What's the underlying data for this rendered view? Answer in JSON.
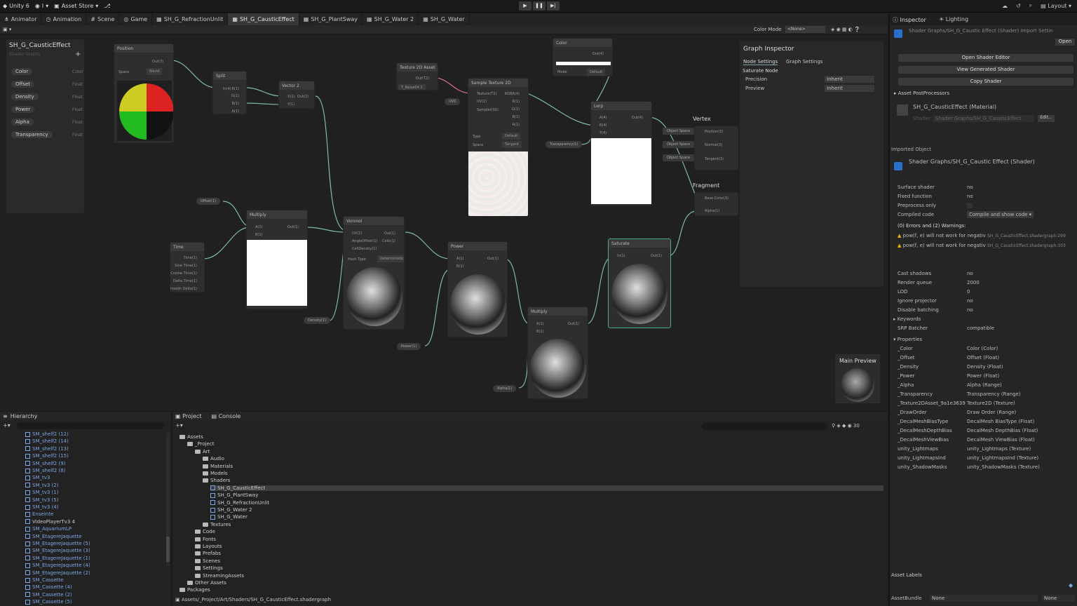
{
  "topbar": {
    "unity": "Unity 6",
    "account": "I",
    "asset_store": "Asset Store",
    "layout": "Layout"
  },
  "tabs": [
    "Animator",
    "Animation",
    "Scene",
    "Game",
    "SH_G_RefractionUnlit",
    "SH_G_CausticEffect",
    "SH_G_PlantSway",
    "SH_G_Water 2",
    "SH_G_Water"
  ],
  "graph_toolbar": {
    "color_mode_label": "Color Mode",
    "color_mode_value": "<None>"
  },
  "blackboard": {
    "title": "SH_G_CausticEffect",
    "subtitle": "Shader Graphs",
    "items": [
      {
        "label": "Color",
        "type": "Color"
      },
      {
        "label": "Offset",
        "type": "Float"
      },
      {
        "label": "Density",
        "type": "Float"
      },
      {
        "label": "Power",
        "type": "Float"
      },
      {
        "label": "Alpha",
        "type": "Float"
      },
      {
        "label": "Transparency",
        "type": "Float"
      }
    ]
  },
  "nodes": {
    "position": {
      "title": "Position",
      "out": "Out(3)",
      "space_label": "Space",
      "space_value": "World"
    },
    "split": {
      "title": "Split",
      "ports": [
        "In(4)",
        "R(1)",
        "G(1)",
        "B(1)",
        "A(1)"
      ]
    },
    "vector2": {
      "title": "Vector 2",
      "ports": [
        "X(1)",
        "Y(1)",
        "Out(2)"
      ]
    },
    "tex2d_asset": {
      "title": "Texture 2D Asset",
      "out": "Out(T2)",
      "asset": "T_Noise04 1"
    },
    "sample_tex": {
      "title": "Sample Texture 2D",
      "ports": [
        "Texture(T2)",
        "UV(2)",
        "Sampler(SS)",
        "RGBA(4)",
        "R(1)",
        "G(1)",
        "B(1)",
        "A(1)"
      ],
      "type_label": "Type",
      "type_value": "Default",
      "space_label": "Space",
      "space_value": "Tangent",
      "uv": "UV0"
    },
    "color": {
      "title": "Color",
      "out": "Out(4)",
      "mode_label": "Mode",
      "mode_value": "Default"
    },
    "lerp": {
      "title": "Lerp",
      "ports": [
        "A(4)",
        "B(4)",
        "T(4)",
        "Out(4)"
      ]
    },
    "offset_pill": "Offset(1)",
    "transparency_pill": "Transparency(1)",
    "multiply1": {
      "title": "Multiply",
      "ports": [
        "A(1)",
        "B(1)",
        "Out(1)"
      ]
    },
    "time": {
      "title": "Time",
      "ports": [
        "Time(1)",
        "Sine Time(1)",
        "Cosine Time(1)",
        "Delta Time(1)",
        "Smooth Delta(1)"
      ]
    },
    "voronoi": {
      "title": "Voronoi",
      "ports": [
        "UV(2)",
        "AngleOffset(1)",
        "CellDensity(1)",
        "Out(1)",
        "Cells(1)"
      ],
      "hash_label": "Hash Type",
      "hash_value": "Deterministic"
    },
    "density_pill": "Density(1)",
    "power": {
      "title": "Power",
      "ports": [
        "A(1)",
        "B(1)",
        "Out(1)"
      ]
    },
    "power_pill": "Power(1)",
    "multiply2": {
      "title": "Multiply",
      "ports": [
        "A(1)",
        "B(1)",
        "Out(1)"
      ]
    },
    "alpha_pill": "Alpha(1)",
    "saturate": {
      "title": "Saturate",
      "ports": [
        "In(1)",
        "Out(1)"
      ]
    },
    "vertex": {
      "title": "Vertex",
      "ports": [
        "Position(3)",
        "Normal(3)",
        "Tangent(3)"
      ],
      "space": "Object Space"
    },
    "fragment": {
      "title": "Fragment",
      "ports": [
        "Base Color(3)",
        "Alpha(1)"
      ]
    }
  },
  "graph_inspector": {
    "title": "Graph Inspector",
    "tab1": "Node Settings",
    "tab2": "Graph Settings",
    "node_name": "Saturate Node",
    "precision_label": "Precision",
    "precision_value": "Inherit",
    "preview_label": "Preview",
    "preview_value": "Inherit"
  },
  "main_preview": {
    "title": "Main Preview"
  },
  "inspector": {
    "tab1": "Inspector",
    "tab2": "Lighting",
    "header": "Shader Graphs/SH_G_Caustic Effect (Shader) Import Settin",
    "open_btn": "Open",
    "btn1": "Open Shader Editor",
    "btn2": "View Generated Shader",
    "btn3": "Copy Shader",
    "postproc": "Asset PostProcessors",
    "material_name": "SH_G_CausticEffect (Material)",
    "material_shader_label": "Shader",
    "material_shader": "Shader Graphs/SH_G_CausticEffect",
    "edit_btn": "Edit...",
    "imported_object": "Imported Object",
    "shader_name": "Shader Graphs/SH_G_Caustic Effect (Shader)",
    "rows1": [
      {
        "k": "Surface shader",
        "v": "no"
      },
      {
        "k": "Fixed function",
        "v": "no"
      },
      {
        "k": "Preprocess only",
        "v": ""
      },
      {
        "k": "Compiled code",
        "v": "Compile and show code"
      }
    ],
    "errors": "(0) Errors and (2) Warnings:",
    "warn1": "pow(f, e) will not work for negativ",
    "warn1_src": "SH_G_CausticEffect.shadergraph:299",
    "warn2": "pow(f, e) will not work for negativ",
    "warn2_src": "SH_G_CausticEffect.shadergraph:303",
    "rows2": [
      {
        "k": "Cast shadows",
        "v": "no"
      },
      {
        "k": "Render queue",
        "v": "2000"
      },
      {
        "k": "LOD",
        "v": "0"
      },
      {
        "k": "Ignore projector",
        "v": "no"
      },
      {
        "k": "Disable batching",
        "v": "no"
      }
    ],
    "keywords": "Keywords",
    "srp_label": "SRP Batcher",
    "srp_value": "compatible",
    "properties": "Properties",
    "props": [
      {
        "k": "_Color",
        "v": "Color (Color)"
      },
      {
        "k": "_Offset",
        "v": "Offset (Float)"
      },
      {
        "k": "_Density",
        "v": "Density (Float)"
      },
      {
        "k": "_Power",
        "v": "Power (Float)"
      },
      {
        "k": "_Alpha",
        "v": "Alpha (Range)"
      },
      {
        "k": "_Transparency",
        "v": "Transparency (Range)"
      },
      {
        "k": "_Texture2DAsset_9a1e3639",
        "v": "Texture2D (Texture)"
      },
      {
        "k": "_DrawOrder",
        "v": "Draw Order (Range)"
      },
      {
        "k": "_DecalMeshBiasType",
        "v": "DecalMesh BiasType (Float)"
      },
      {
        "k": "_DecalMeshDepthBias",
        "v": "DecalMesh DepthBias (Float)"
      },
      {
        "k": "_DecalMeshViewBias",
        "v": "DecalMesh ViewBias (Float)"
      },
      {
        "k": "unity_Lightmaps",
        "v": "unity_Lightmaps (Texture)"
      },
      {
        "k": "unity_LightmapsInd",
        "v": "unity_LightmapsInd (Texture)"
      },
      {
        "k": "unity_ShadowMasks",
        "v": "unity_ShadowMasks (Texture)"
      }
    ],
    "asset_labels": "Asset Labels",
    "assetbundle_label": "AssetBundle",
    "assetbundle_value": "None",
    "assetbundle_variant": "None"
  },
  "hierarchy": {
    "title": "Hierarchy",
    "items": [
      "SM_shelf2 (12)",
      "SM_shelf2 (14)",
      "SM_shelf2 (13)",
      "SM_shelf2 (15)",
      "SM_shelf2 (9)",
      "SM_shelf2 (8)",
      "SM_tv3",
      "SM_tv3 (2)",
      "SM_tv3 (1)",
      "SM_tv3 (5)",
      "SM_tv3 (4)",
      "Enseinte",
      "VideoPlayerTv3 4",
      "SM_AquariumLP",
      "SM_EtagereJaquette",
      "SM_EtagereJaquette (5)",
      "SM_EtagereJaquette (3)",
      "SM_EtagereJaquette (1)",
      "SM_EtagereJaquette (4)",
      "SM_EtagereJaquette (2)",
      "SM_Cassette",
      "SM_Cassette (4)",
      "SM_Cassette (2)",
      "SM_Cassette (5)"
    ]
  },
  "project": {
    "tab1": "Project",
    "tab2": "Console",
    "count": "30",
    "tree": [
      {
        "label": "Assets",
        "indent": 0,
        "kind": "folder"
      },
      {
        "label": "_Project",
        "indent": 1,
        "kind": "folder"
      },
      {
        "label": "Art",
        "indent": 2,
        "kind": "folder"
      },
      {
        "label": "Audio",
        "indent": 3,
        "kind": "folder"
      },
      {
        "label": "Materials",
        "indent": 3,
        "kind": "folder"
      },
      {
        "label": "Models",
        "indent": 3,
        "kind": "folder"
      },
      {
        "label": "Shaders",
        "indent": 3,
        "kind": "folder"
      },
      {
        "label": "SH_G_CausticEffect",
        "indent": 4,
        "kind": "asset"
      },
      {
        "label": "SH_G_PlantSway",
        "indent": 4,
        "kind": "asset"
      },
      {
        "label": "SH_G_RefractionUnlit",
        "indent": 4,
        "kind": "asset"
      },
      {
        "label": "SH_G_Water 2",
        "indent": 4,
        "kind": "asset"
      },
      {
        "label": "SH_G_Water",
        "indent": 4,
        "kind": "asset"
      },
      {
        "label": "Textures",
        "indent": 3,
        "kind": "folder"
      },
      {
        "label": "Code",
        "indent": 2,
        "kind": "folder"
      },
      {
        "label": "Fonts",
        "indent": 2,
        "kind": "folder"
      },
      {
        "label": "Layouts",
        "indent": 2,
        "kind": "folder"
      },
      {
        "label": "Prefabs",
        "indent": 2,
        "kind": "folder"
      },
      {
        "label": "Scenes",
        "indent": 2,
        "kind": "folder"
      },
      {
        "label": "Settings",
        "indent": 2,
        "kind": "folder"
      },
      {
        "label": "StreamingAssets",
        "indent": 2,
        "kind": "folder"
      },
      {
        "label": "Other Assets",
        "indent": 1,
        "kind": "folder"
      },
      {
        "label": "Packages",
        "indent": 0,
        "kind": "folder"
      }
    ],
    "path": "Assets/_Project/Art/Shaders/SH_G_CausticEffect.shadergraph"
  }
}
